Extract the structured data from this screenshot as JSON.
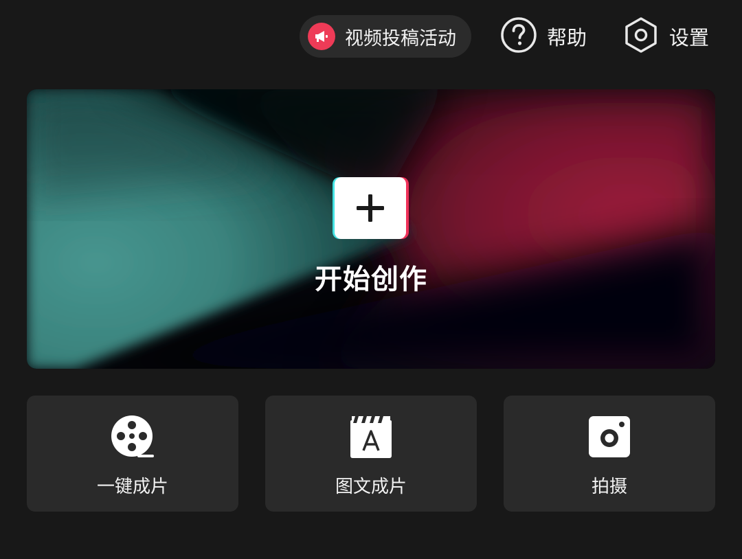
{
  "header": {
    "campaign_label": "视频投稿活动",
    "help_label": "帮助",
    "settings_label": "设置",
    "campaign_icon": "megaphone-icon",
    "help_icon": "question-circle-icon",
    "settings_icon": "hexagon-gear-icon"
  },
  "hero": {
    "label": "开始创作",
    "icon": "plus-icon"
  },
  "actions": [
    {
      "label": "一键成片",
      "icon": "film-reel-icon"
    },
    {
      "label": "图文成片",
      "icon": "text-clapboard-icon"
    },
    {
      "label": "拍摄",
      "icon": "camera-icon"
    }
  ],
  "colors": {
    "background": "#181818",
    "pill": "#2b2b2b",
    "accent_red": "#ee3b57",
    "teal": "#3f8c86",
    "crimson": "#a21f3c",
    "card": "#2a2a2a"
  }
}
